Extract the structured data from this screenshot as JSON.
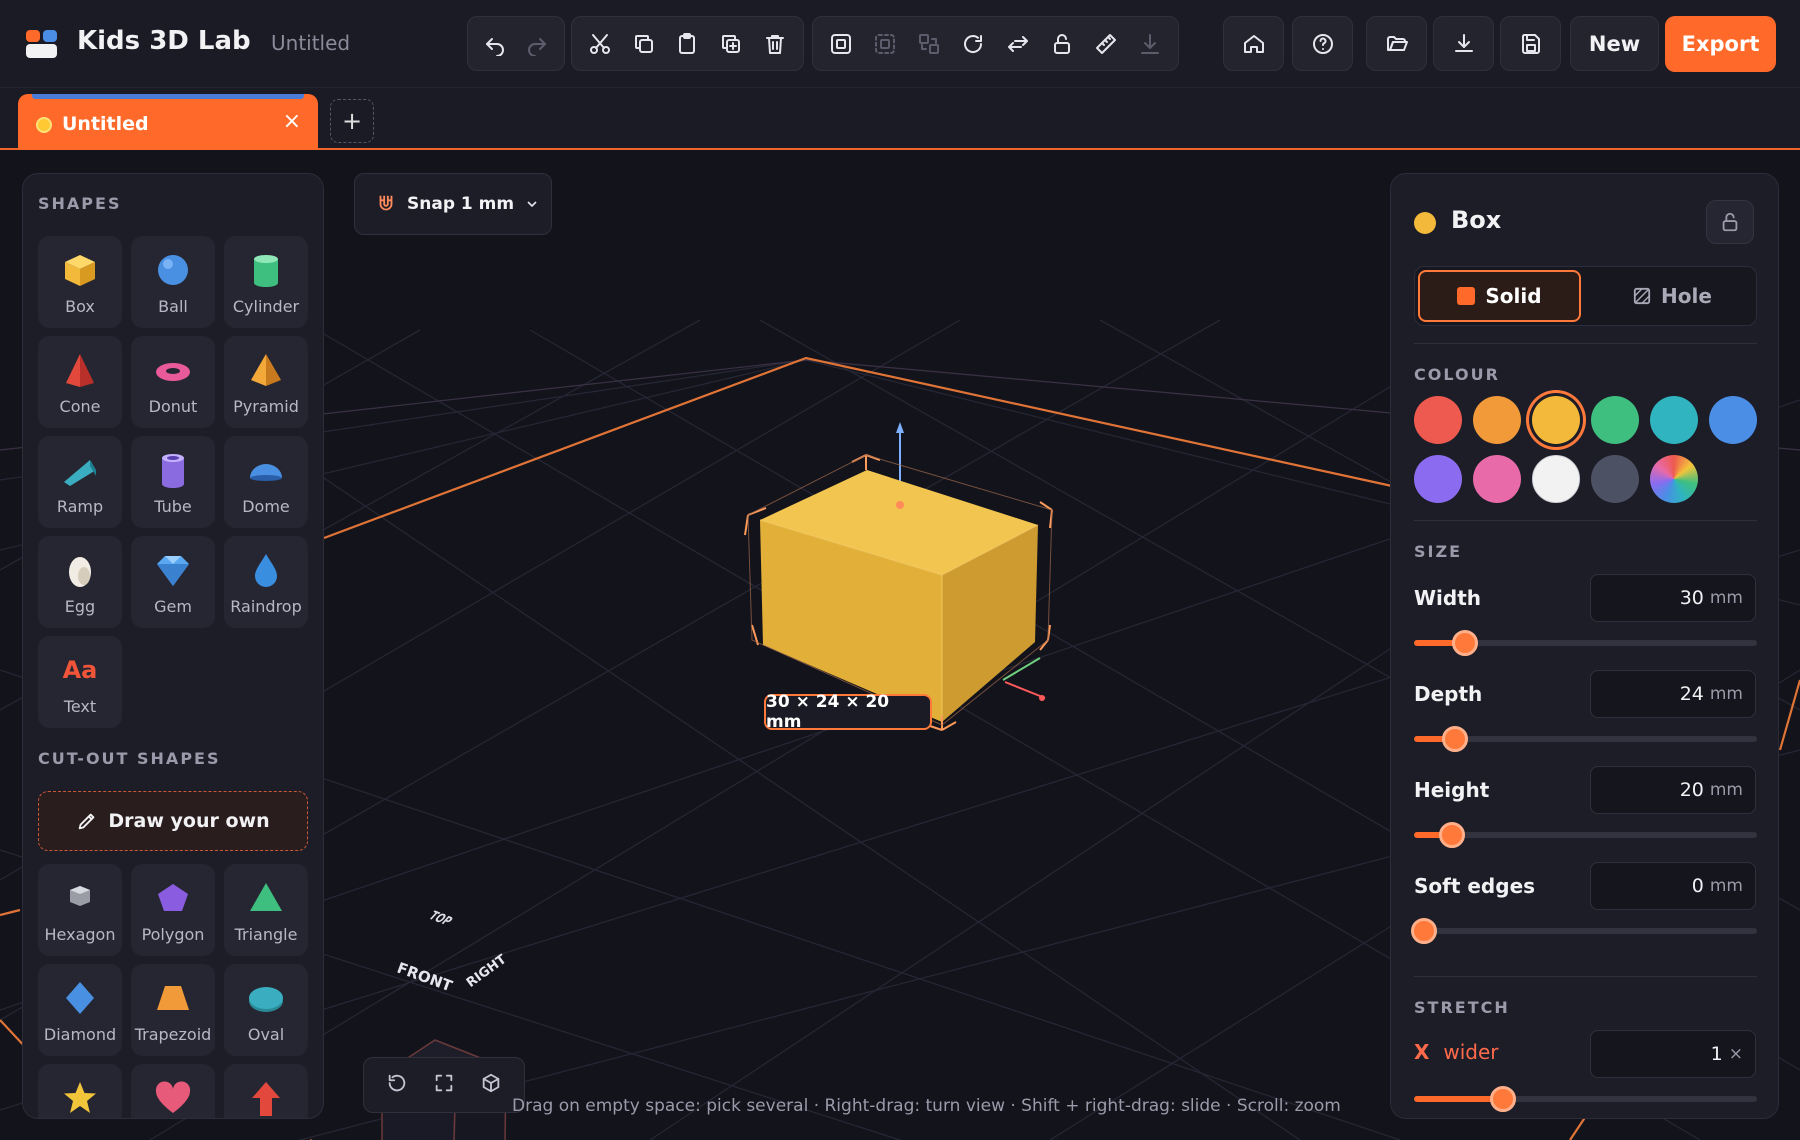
{
  "app": {
    "title": "Kids 3D Lab",
    "document_name": "Untitled"
  },
  "toolbar": {
    "edit_group": [
      "undo-icon",
      "redo-icon"
    ],
    "clip_group": [
      "cut-icon",
      "copy-icon",
      "paste-icon",
      "duplicate-icon",
      "delete-icon"
    ],
    "arrange_group": [
      "group-icon",
      "ungroup-icon",
      "align-icon",
      "rotate-icon",
      "flip-icon",
      "unlock-icon",
      "ruler-icon",
      "drop-to-floor-icon"
    ],
    "right_buttons": [
      "home-icon",
      "help-icon",
      "open-folder-icon",
      "download-icon",
      "save-icon"
    ],
    "new_label": "New",
    "export_label": "Export"
  },
  "tabs": [
    {
      "label": "Untitled",
      "close": "×"
    }
  ],
  "add_tab_label": "+",
  "left_panel": {
    "shapes_heading": "SHAPES",
    "shapes": [
      {
        "name": "Box",
        "icon": "box-icon",
        "color": "#f3b93a"
      },
      {
        "name": "Ball",
        "icon": "ball-icon",
        "color": "#4a90e2"
      },
      {
        "name": "Cylinder",
        "icon": "cylinder-icon",
        "color": "#3fbf7f"
      },
      {
        "name": "Cone",
        "icon": "cone-icon",
        "color": "#e2483c"
      },
      {
        "name": "Donut",
        "icon": "donut-icon",
        "color": "#e85a9a"
      },
      {
        "name": "Pyramid",
        "icon": "pyramid-icon",
        "color": "#f19a3a"
      },
      {
        "name": "Ramp",
        "icon": "ramp-icon",
        "color": "#3aaec0"
      },
      {
        "name": "Tube",
        "icon": "tube-icon",
        "color": "#8a6ce0"
      },
      {
        "name": "Dome",
        "icon": "dome-icon",
        "color": "#4a90e2"
      },
      {
        "name": "Egg",
        "icon": "egg-icon",
        "color": "#f1ede4"
      },
      {
        "name": "Gem",
        "icon": "gem-icon",
        "color": "#5aa8f0"
      },
      {
        "name": "Raindrop",
        "icon": "raindrop-icon",
        "color": "#3a8ee0"
      },
      {
        "name": "Text",
        "icon": "text-icon",
        "color": "#f0553a"
      }
    ],
    "cutout_heading": "CUT-OUT SHAPES",
    "draw_own_label": "Draw your own",
    "cutouts": [
      {
        "name": "Hexagon",
        "icon": "hexagon-icon",
        "color": "#c9cbd3"
      },
      {
        "name": "Polygon",
        "icon": "polygon-icon",
        "color": "#8a5ce0"
      },
      {
        "name": "Triangle",
        "icon": "triangle-icon",
        "color": "#3fbf7f"
      },
      {
        "name": "Diamond",
        "icon": "diamond-icon",
        "color": "#4a90e2"
      },
      {
        "name": "Trapezoid",
        "icon": "trapezoid-icon",
        "color": "#f19a3a"
      },
      {
        "name": "Oval",
        "icon": "oval-icon",
        "color": "#3aaec0"
      },
      {
        "name": "",
        "icon": "star-icon",
        "color": "#f3c53a"
      },
      {
        "name": "",
        "icon": "heart-icon",
        "color": "#e85a7a"
      },
      {
        "name": "",
        "icon": "arrow-icon",
        "color": "#e2483c"
      }
    ]
  },
  "viewport": {
    "snap_label": "Snap 1 mm",
    "dimensions_label": "30 × 24 × 20 mm",
    "view_cube": {
      "top": "TOP",
      "front": "FRONT",
      "right": "RIGHT"
    },
    "hint": "Drag on empty space: pick several · Right-drag: turn view · Shift + right-drag: slide · Scroll: zoom",
    "controls": [
      "reset-view-icon",
      "fit-view-icon",
      "perspective-icon"
    ]
  },
  "right_panel": {
    "object_name": "Box",
    "object_color": "#f3b93a",
    "mode": {
      "solid": "Solid",
      "hole": "Hole",
      "selected": "Solid"
    },
    "colour_heading": "COLOUR",
    "colours": [
      "#ee5a4f",
      "#f29a3a",
      "#f3b93a",
      "#3fbf7f",
      "#2fb4c0",
      "#4a8ee6",
      "#8b6cf0",
      "#e86aa8",
      "#f2f2f2",
      "#4c5263",
      "rainbow"
    ],
    "selected_colour": "#f3b93a",
    "size_heading": "SIZE",
    "fields": [
      {
        "label": "Width",
        "value": "30",
        "unit": "mm",
        "fraction": 0.15
      },
      {
        "label": "Depth",
        "value": "24",
        "unit": "mm",
        "fraction": 0.12
      },
      {
        "label": "Height",
        "value": "20",
        "unit": "mm",
        "fraction": 0.11
      },
      {
        "label": "Soft edges",
        "value": "0",
        "unit": "mm",
        "fraction": 0.03
      }
    ],
    "stretch_heading": "STRETCH",
    "stretch": {
      "axis": "X",
      "label": "wider",
      "value": "1",
      "unit": "×",
      "fraction": 0.26
    }
  }
}
